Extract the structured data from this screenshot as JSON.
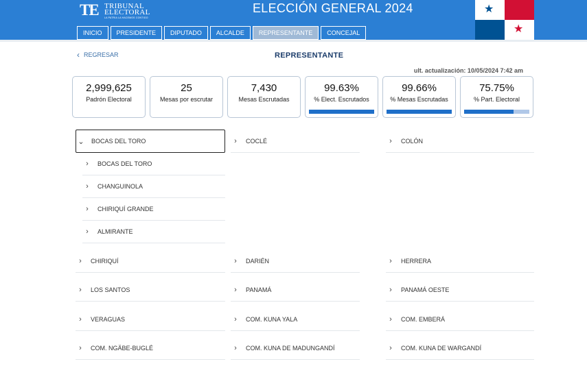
{
  "header": {
    "logo_mark": "TE",
    "logo_line1": "TRIBUNAL",
    "logo_line2": "ELECTORAL",
    "logo_tagline": "LA PATRIA LA HACEMOS CONTIGO",
    "title": "ELECCIÓN GENERAL 2024",
    "flag_colors": {
      "blue": "#005293",
      "red": "#d21034"
    }
  },
  "nav": {
    "tabs": [
      "INICIO",
      "PRESIDENTE",
      "DIPUTADO",
      "ALCALDE",
      "REPRESENTANTE",
      "CONCEJAL"
    ],
    "active": "REPRESENTANTE"
  },
  "page": {
    "back_label": "REGRESAR",
    "title": "REPRESENTANTE",
    "updated": "ult. actualización: 10/05/2024 7:42 am"
  },
  "stats": [
    {
      "value": "2,999,625",
      "label": "Padrón Electoral"
    },
    {
      "value": "25",
      "label": "Mesas por escrutar"
    },
    {
      "value": "7,430",
      "label": "Mesas Escrutadas"
    },
    {
      "value": "99.63%",
      "label": "% Elect. Escrutados",
      "progress": 0.9963
    },
    {
      "value": "99.66%",
      "label": "% Mesas Escrutadas",
      "progress": 0.9966
    },
    {
      "value": "75.75%",
      "label": "% Part. Electoral",
      "progress": 0.7575
    }
  ],
  "provinces": {
    "expanded": "BOCAS DEL TORO",
    "row1": [
      "BOCAS DEL TORO",
      "COCLÉ",
      "COLÓN"
    ],
    "districts": [
      "BOCAS DEL TORO",
      "CHANGUINOLA",
      "CHIRIQUÍ GRANDE",
      "ALMIRANTE"
    ],
    "row2": [
      "CHIRIQUÍ",
      "DARIÉN",
      "HERRERA"
    ],
    "row3": [
      "LOS SANTOS",
      "PANAMÁ",
      "PANAMÁ OESTE"
    ],
    "row4": [
      "VERAGUAS",
      "COM. KUNA YALA",
      "COM. EMBERÁ"
    ],
    "row5": [
      "COM. NGÄBE-BUGLÉ",
      "COM. KUNA DE MADUNGANDÍ",
      "COM. KUNA DE WARGANDÍ"
    ]
  },
  "colors": {
    "header": "#2b7fd4",
    "progress_fill": "#1f6fc9",
    "progress_track": "#b0c8e8"
  }
}
